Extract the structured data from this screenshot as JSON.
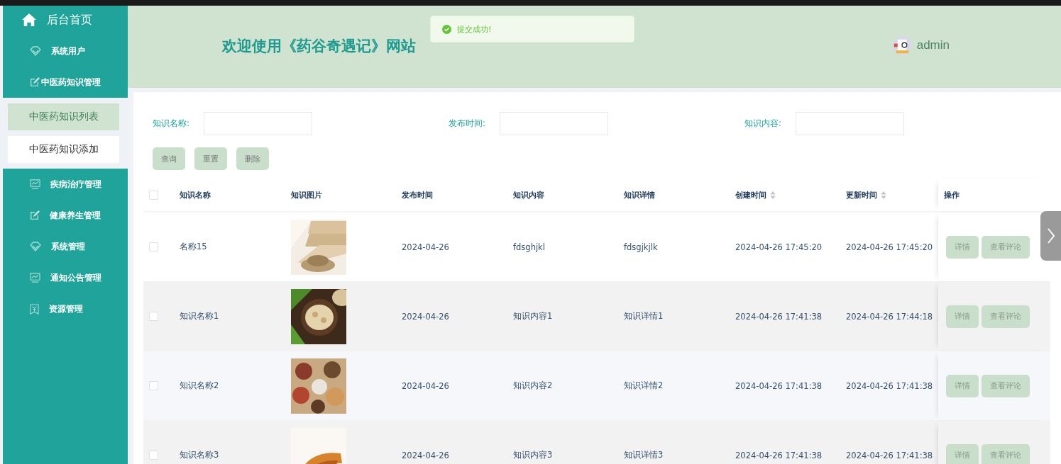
{
  "sidebar": {
    "home": "后台首页",
    "items": [
      {
        "label": "系统用户",
        "kind": "diamond"
      },
      {
        "label": "中医药知识管理",
        "kind": "edit",
        "children": [
          {
            "label": "中医药知识列表",
            "selected": true
          },
          {
            "label": "中医药知识添加",
            "selected": false
          }
        ]
      },
      {
        "label": "疾病治疗管理",
        "kind": "chart"
      },
      {
        "label": "健康养生管理",
        "kind": "edit"
      },
      {
        "label": "系统管理",
        "kind": "diamond"
      },
      {
        "label": "通知公告管理",
        "kind": "chart"
      },
      {
        "label": "资源管理",
        "kind": "money"
      }
    ]
  },
  "header": {
    "title": "欢迎使用《药谷奇遇记》网站",
    "user": "admin"
  },
  "toast": {
    "message": "提交成功!"
  },
  "search": {
    "fields": [
      {
        "label": "知识名称:"
      },
      {
        "label": "发布时间:"
      },
      {
        "label": "知识内容:"
      }
    ],
    "buttons": [
      "查询",
      "重置",
      "删除"
    ]
  },
  "table": {
    "all_checked": false,
    "columns": [
      {
        "label": "知识名称",
        "sortable": false
      },
      {
        "label": "知识图片",
        "sortable": false
      },
      {
        "label": "发布时间",
        "sortable": false
      },
      {
        "label": "知识内容",
        "sortable": false
      },
      {
        "label": "知识详情",
        "sortable": false
      },
      {
        "label": "创建时间",
        "sortable": true
      },
      {
        "label": "更新时间",
        "sortable": true
      },
      {
        "label": "操作",
        "sortable": false
      }
    ],
    "rows": [
      {
        "checked": false,
        "name": "名称15",
        "date": "2024-04-26",
        "content": "fdsghjkl",
        "detail": "fdsgjkjlk",
        "created": "2024-04-26 17:45:20",
        "updated": "2024-04-26 17:45:20",
        "actions": [
          "详情",
          "查看评论"
        ]
      },
      {
        "checked": false,
        "name": "知识名称1",
        "date": "2024-04-26",
        "content": "知识内容1",
        "detail": "知识详情1",
        "created": "2024-04-26 17:41:38",
        "updated": "2024-04-26 17:44:18",
        "actions": [
          "详情",
          "查看评论"
        ]
      },
      {
        "checked": false,
        "name": "知识名称2",
        "date": "2024-04-26",
        "content": "知识内容2",
        "detail": "知识详情2",
        "created": "2024-04-26 17:41:38",
        "updated": "2024-04-26 17:41:38",
        "actions": [
          "详情",
          "查看评论"
        ]
      },
      {
        "checked": false,
        "name": "知识名称3",
        "date": "2024-04-26",
        "content": "知识内容3",
        "detail": "知识详情3",
        "created": "2024-04-26 17:41:38",
        "updated": "2024-04-26 17:41:38",
        "actions": [
          "详情",
          "查看评论"
        ]
      }
    ]
  }
}
